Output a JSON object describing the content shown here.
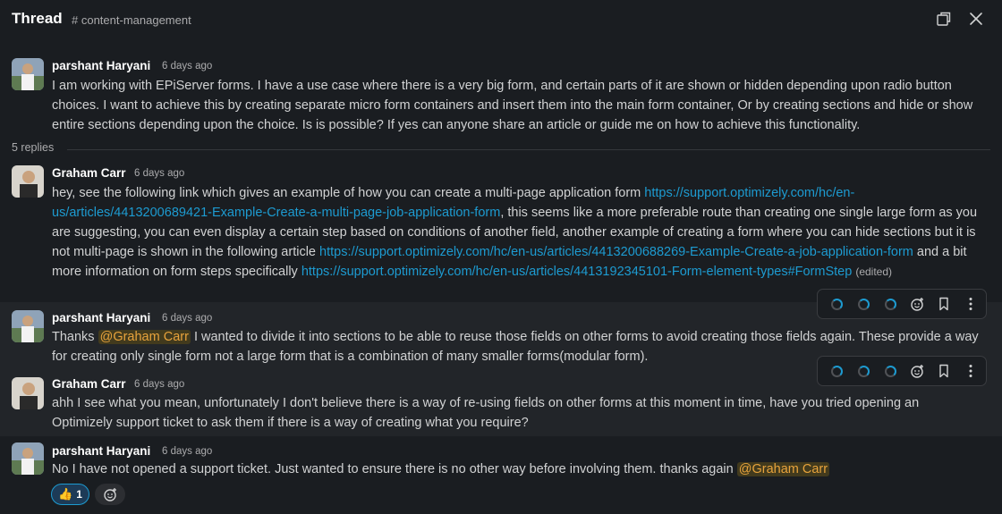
{
  "header": {
    "title": "Thread",
    "channel": "# content-management"
  },
  "messages": [
    {
      "author": "parshant Haryani",
      "time": "6 days ago",
      "text": "I am working with EPiServer forms. I have a use case where there is a very big form, and certain parts of it are shown or hidden depending upon radio button choices. I want to achieve this by creating separate micro form containers and insert them into the main form container, Or by creating sections and hide or show entire sections depending upon the choice. Is is possible? If yes can anyone share an article or guide me on how to achieve this functionality."
    },
    {
      "author": "Graham Carr",
      "time": "6 days ago",
      "text_1": "hey, see the following link which gives an example of how you can create a multi-page application form ",
      "link_1": "https://support.optimizely.com/hc/en-us/articles/4413200689421-Example-Create-a-multi-page-job-application-form",
      "text_2": ", this seems like a more preferable route than creating one single large form as you are suggesting, you can even display a certain step based on conditions of another field, another example of creating a form where you can hide sections but it is not multi-page is shown in the following article ",
      "link_2": "https://support.optimizely.com/hc/en-us/articles/4413200688269-Example-Create-a-job-application-form",
      "text_3": " and a bit more information on form steps specifically ",
      "link_3": "https://support.optimizely.com/hc/en-us/articles/4413192345101-Form-element-types#FormStep",
      "edited": "(edited)"
    },
    {
      "author": "parshant Haryani",
      "time": "6 days ago",
      "text_1": "Thanks ",
      "mention": "@Graham Carr",
      "text_2": " I wanted to divide it into sections to be able to reuse those fields on other forms to avoid creating those fields again. These provide a way for creating only single form not a large form that is a combination of many smaller forms(modular form)."
    },
    {
      "author": "Graham Carr",
      "time": "6 days ago",
      "text": "ahh I see what you mean, unfortunately I don't believe there is a way of re-using fields on other forms at this moment in time, have you tried opening an Optimizely support ticket to ask them if there is a way of creating what you require?"
    },
    {
      "author": "parshant Haryani",
      "time": "6 days ago",
      "text_1": "No I have not opened a support ticket. Just wanted to ensure there is no other way before involving them. thanks again ",
      "mention": "@Graham Carr"
    }
  ],
  "replies_label": "5 replies",
  "reaction": {
    "emoji": "👍",
    "count": "1"
  },
  "icons": {
    "header": [
      "open-in-window-icon",
      "close-icon"
    ],
    "toolbar": [
      "loading-spinner-icon",
      "loading-spinner-icon",
      "loading-spinner-icon",
      "add-reaction-icon",
      "bookmark-icon",
      "more-actions-icon"
    ]
  },
  "colors": {
    "background": "#1a1d21",
    "hover_row": "#222529",
    "link": "#1d9bd1",
    "mention_text": "#e8a33c",
    "mention_bg": "#423a1d"
  }
}
